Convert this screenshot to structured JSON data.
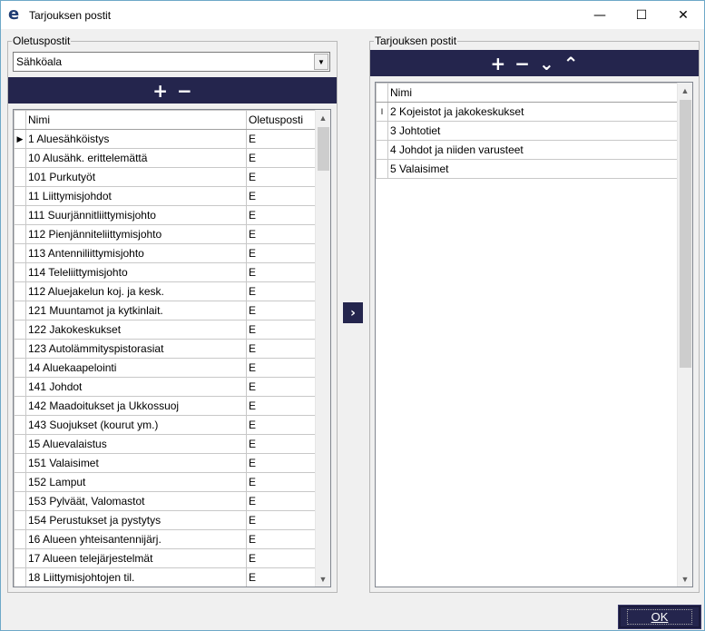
{
  "window": {
    "title": "Tarjouksen postit",
    "logo": "e",
    "minimize": "—",
    "maximize": "☐",
    "close": "✕"
  },
  "left": {
    "group_label": "Oletuspostit",
    "combo_value": "Sähköala",
    "toolbar": {
      "add": "+",
      "remove": "−"
    },
    "columns": [
      "Nimi",
      "Oletusposti"
    ],
    "rows": [
      {
        "name": "1 Aluesähköistys",
        "value": "E"
      },
      {
        "name": "10 Alusähk. erittelemättä",
        "value": "E"
      },
      {
        "name": "101 Purkutyöt",
        "value": "E"
      },
      {
        "name": "11 Liittymisjohdot",
        "value": "E"
      },
      {
        "name": "111 Suurjännitliittymisjohto",
        "value": "E"
      },
      {
        "name": "112 Pienjänniteliittymisjohto",
        "value": "E"
      },
      {
        "name": "113 Antenniliittymisjohto",
        "value": "E"
      },
      {
        "name": "114 Teleliittymisjohto",
        "value": "E"
      },
      {
        "name": "112 Aluejakelun koj. ja kesk.",
        "value": "E"
      },
      {
        "name": "121 Muuntamot ja kytkinlait.",
        "value": "E"
      },
      {
        "name": "122 Jakokeskukset",
        "value": "E"
      },
      {
        "name": "123 Autolämmityspistorasiat",
        "value": "E"
      },
      {
        "name": "14 Aluekaapelointi",
        "value": "E"
      },
      {
        "name": "141 Johdot",
        "value": "E"
      },
      {
        "name": "142 Maadoitukset ja Ukkossuoj",
        "value": "E"
      },
      {
        "name": "143 Suojukset (kourut ym.)",
        "value": "E"
      },
      {
        "name": "15 Aluevalaistus",
        "value": "E"
      },
      {
        "name": "151 Valaisimet",
        "value": "E"
      },
      {
        "name": "152 Lamput",
        "value": "E"
      },
      {
        "name": "153 Pylväät, Valomastot",
        "value": "E"
      },
      {
        "name": "154 Perustukset ja pystytys",
        "value": "E"
      },
      {
        "name": "16 Alueen yhteisantennijärj.",
        "value": "E"
      },
      {
        "name": "17 Alueen telejärjestelmät",
        "value": "E"
      },
      {
        "name": "18 Liittymisjohtojen til.",
        "value": "E"
      }
    ]
  },
  "move_button": "›",
  "right": {
    "group_label": "Tarjouksen postit",
    "toolbar": {
      "add": "+",
      "remove": "−",
      "down": "⌄",
      "up": "⌃"
    },
    "columns": [
      "Nimi"
    ],
    "rows": [
      {
        "name": "2 Kojeistot ja jakokeskukset"
      },
      {
        "name": "3 Johtotiet"
      },
      {
        "name": "4 Johdot ja niiden varusteet"
      },
      {
        "name": "5 Valaisimet"
      }
    ]
  },
  "ok_label": "OK"
}
